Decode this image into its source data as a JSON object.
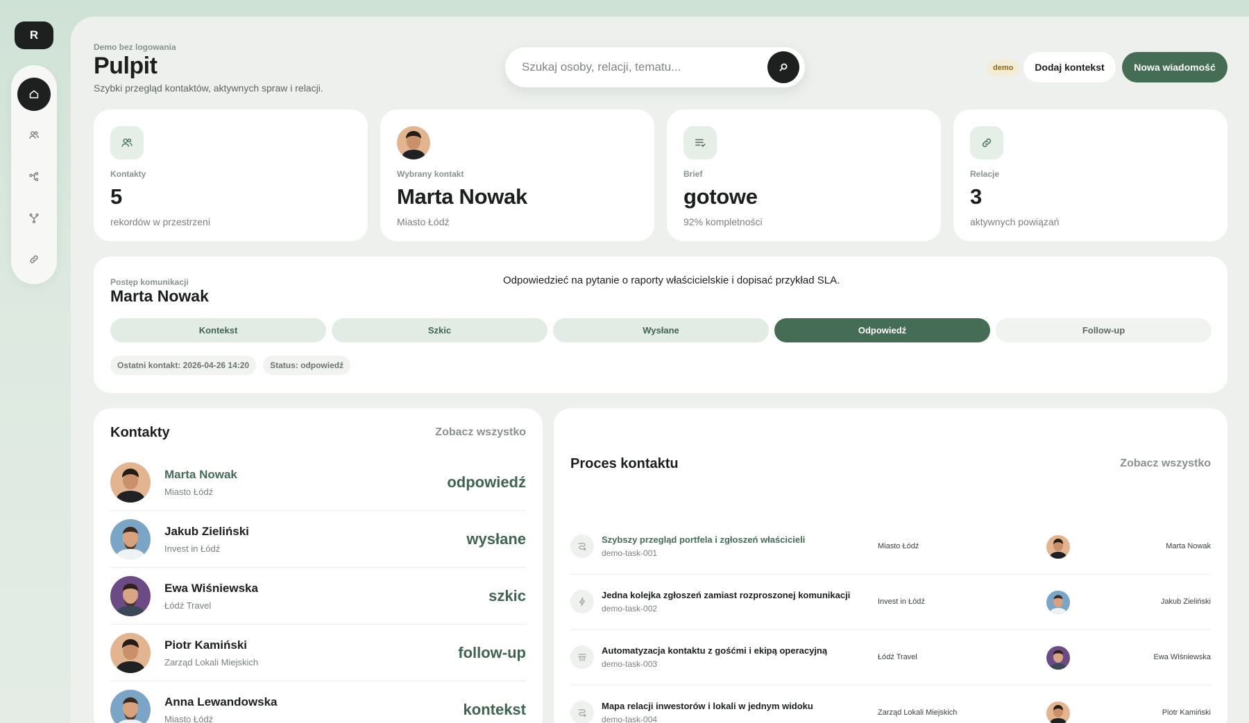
{
  "rail": {
    "logo": "R",
    "items": [
      {
        "name": "home-icon"
      },
      {
        "name": "users-icon"
      },
      {
        "name": "share-icon"
      },
      {
        "name": "merge-icon"
      },
      {
        "name": "link-icon"
      }
    ]
  },
  "header": {
    "eyebrow": "Demo bez logowania",
    "title": "Pulpit",
    "subtitle": "Szybki przegląd kontaktów, aktywnych spraw i relacji.",
    "search_placeholder": "Szukaj osoby, relacji, tematu...",
    "demo_badge": "demo",
    "add_context": "Dodaj kontekst",
    "new_message": "Nowa wiadomość"
  },
  "kpis": [
    {
      "label": "Kontakty",
      "value": "5",
      "sub": "rekordów w przestrzeni",
      "icon": "users-icon"
    },
    {
      "label": "Wybrany kontakt",
      "value": "Marta Nowak",
      "sub": "Miasto Łódź",
      "icon": "avatar"
    },
    {
      "label": "Brief",
      "value": "gotowe",
      "sub": "92% kompletności",
      "icon": "list-check-icon"
    },
    {
      "label": "Relacje",
      "value": "3",
      "sub": "aktywnych powiązań",
      "icon": "link-icon"
    }
  ],
  "progress": {
    "eyebrow": "Postęp komunikacji",
    "name": "Marta Nowak",
    "note": "Odpowiedzieć na pytanie o raporty właścicielskie i dopisać przykład SLA.",
    "steps": [
      "Kontekst",
      "Szkic",
      "Wysłane",
      "Odpowiedź",
      "Follow-up"
    ],
    "active_step": 3,
    "last_contact": "Ostatni kontakt: 2026-04-26 14:20",
    "status": "Status: odpowiedź"
  },
  "contacts": {
    "title": "Kontakty",
    "see_all": "Zobacz wszystko",
    "items": [
      {
        "name": "Marta Nowak",
        "org": "Miasto Łódź",
        "status": "odpowiedź"
      },
      {
        "name": "Jakub Zieliński",
        "org": "Invest in Łódź",
        "status": "wysłane"
      },
      {
        "name": "Ewa Wiśniewska",
        "org": "Łódź Travel",
        "status": "szkic"
      },
      {
        "name": "Piotr Kamiński",
        "org": "Zarząd Lokali Miejskich",
        "status": "follow-up"
      },
      {
        "name": "Anna Lewandowska",
        "org": "Miasto Łódź",
        "status": "kontekst"
      }
    ]
  },
  "process": {
    "title": "Proces kontaktu",
    "see_all": "Zobacz wszystko",
    "items": [
      {
        "title": "Szybszy przegląd portfela i zgłoszeń właścicieli",
        "id": "demo-task-001",
        "org": "Miasto Łódź",
        "person": "Marta Nowak",
        "icon": "route-icon"
      },
      {
        "title": "Jedna kolejka zgłoszeń zamiast rozproszonej komunikacji",
        "id": "demo-task-002",
        "org": "Invest in Łódź",
        "person": "Jakub Zieliński",
        "icon": "bolt-icon"
      },
      {
        "title": "Automatyzacja kontaktu z gośćmi i ekipą operacyjną",
        "id": "demo-task-003",
        "org": "Łódź Travel",
        "person": "Ewa Wiśniewska",
        "icon": "settings-sliders-icon"
      },
      {
        "title": "Mapa relacji inwestorów i lokali w jednym widoku",
        "id": "demo-task-004",
        "org": "Zarząd Lokali Miejskich",
        "person": "Piotr Kamiński",
        "icon": "route-icon"
      }
    ]
  },
  "colors": {
    "accent": "#456c55",
    "accent_soft": "#e3ebe5",
    "dark": "#1d201e",
    "demo_badge_bg": "#f3ecd7"
  }
}
